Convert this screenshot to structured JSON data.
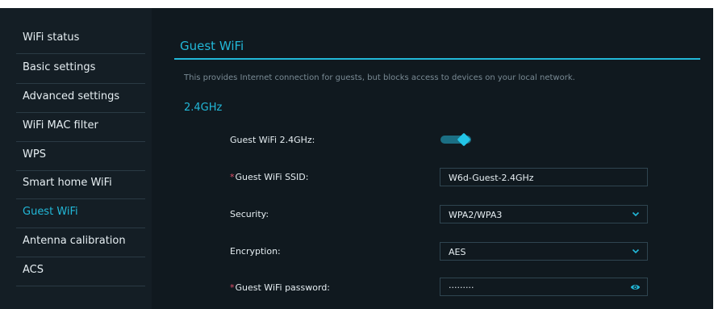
{
  "sidebar": {
    "items": [
      {
        "label": "WiFi status"
      },
      {
        "label": "Basic settings"
      },
      {
        "label": "Advanced settings"
      },
      {
        "label": "WiFi MAC filter"
      },
      {
        "label": "WPS"
      },
      {
        "label": "Smart home WiFi"
      },
      {
        "label": "Guest WiFi"
      },
      {
        "label": "Antenna calibration"
      },
      {
        "label": "ACS"
      }
    ],
    "active": "Guest WiFi"
  },
  "page": {
    "title": "Guest WiFi",
    "description": "This provides Internet connection for guests, but blocks access to devices on your local network.",
    "section_title": "2.4GHz"
  },
  "form": {
    "guest_toggle": {
      "label": "Guest WiFi 2.4GHz:",
      "enabled": true
    },
    "ssid": {
      "required_mark": "*",
      "label": "Guest WiFi SSID:",
      "value": "W6d-Guest-2.4GHz"
    },
    "security": {
      "label": "Security:",
      "value": "WPA2/WPA3"
    },
    "encryption": {
      "label": "Encryption:",
      "value": "AES"
    },
    "password": {
      "required_mark": "*",
      "label": "Guest WiFi password:",
      "value": "·········"
    }
  },
  "colors": {
    "accent": "#22b8d8",
    "background": "#10191f",
    "sidebar_bg": "#141e25",
    "required": "#e0506a"
  },
  "icons": {
    "dropdown": "chevron-down-icon",
    "password_visibility": "eye-icon"
  }
}
